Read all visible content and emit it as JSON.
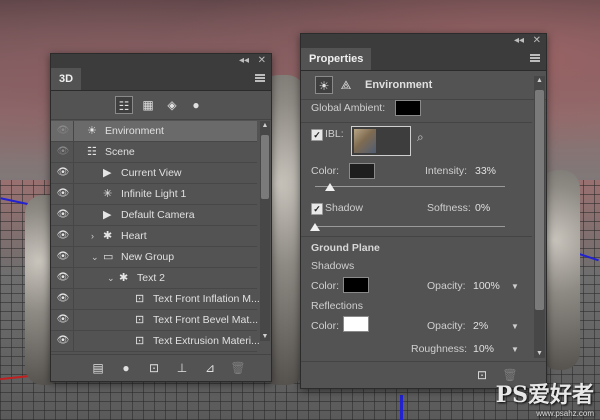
{
  "panel_3d": {
    "tab_label": "3D",
    "collapse_glyph": "◂◂",
    "close_glyph": "✕",
    "layers": [
      {
        "name": "Environment",
        "indent": 0,
        "icon": "environment-icon",
        "glyph": "☀",
        "selected": true,
        "eye": "dim"
      },
      {
        "name": "Scene",
        "indent": 0,
        "icon": "scene-icon",
        "glyph": "☷",
        "selected": false,
        "eye": "dim"
      },
      {
        "name": "Current View",
        "indent": 1,
        "icon": "camera-icon",
        "glyph": "▶",
        "selected": false,
        "eye": "on"
      },
      {
        "name": "Infinite Light 1",
        "indent": 1,
        "icon": "light-icon",
        "glyph": "✳",
        "selected": false,
        "eye": "on"
      },
      {
        "name": "Default Camera",
        "indent": 1,
        "icon": "camera-icon",
        "glyph": "▶",
        "selected": false,
        "eye": "on"
      },
      {
        "name": "Heart",
        "indent": 1,
        "icon": "mesh-icon",
        "glyph": "✱",
        "twisty": "›",
        "selected": false,
        "eye": "on"
      },
      {
        "name": "New Group",
        "indent": 1,
        "icon": "folder-icon",
        "glyph": "▭",
        "twisty": "⌄",
        "selected": false,
        "eye": "on"
      },
      {
        "name": "Text 2",
        "indent": 2,
        "icon": "mesh-icon",
        "glyph": "✱",
        "twisty": "⌄",
        "selected": false,
        "eye": "on"
      },
      {
        "name": "Text Front Inflation M...",
        "indent": 3,
        "icon": "material-icon",
        "glyph": "⊡",
        "selected": false,
        "eye": "on"
      },
      {
        "name": "Text Front Bevel Mat...",
        "indent": 3,
        "icon": "material-icon",
        "glyph": "⊡",
        "selected": false,
        "eye": "on"
      },
      {
        "name": "Text Extrusion Materi...",
        "indent": 3,
        "icon": "material-icon",
        "glyph": "⊡",
        "selected": false,
        "eye": "on"
      }
    ]
  },
  "properties": {
    "tab_label": "Properties",
    "section_title": "Environment",
    "global_ambient_label": "Global Ambient:",
    "ibl_label": "IBL:",
    "color_label": "Color:",
    "intensity_label": "Intensity:",
    "intensity_value": "33%",
    "intensity_fraction": 0.08,
    "shadow_label": "Shadow",
    "softness_label": "Softness:",
    "softness_value": "0%",
    "softness_fraction": 0.0,
    "ground_plane_title": "Ground Plane",
    "shadows_title": "Shadows",
    "shadows_color_label": "Color:",
    "shadows_opacity_label": "Opacity:",
    "shadows_opacity_value": "100%",
    "reflections_title": "Reflections",
    "reflections_color_label": "Color:",
    "reflections_opacity_label": "Opacity:",
    "reflections_opacity_value": "2%",
    "roughness_label": "Roughness:",
    "roughness_value": "10%",
    "colors": {
      "global_ambient": "#000000",
      "ibl_color": "#1e1e1e",
      "shadow_color": "#000000",
      "reflection_color": "#ffffff"
    }
  },
  "watermark": {
    "brand": "PS爱好者",
    "url": "www.psahz.com"
  }
}
